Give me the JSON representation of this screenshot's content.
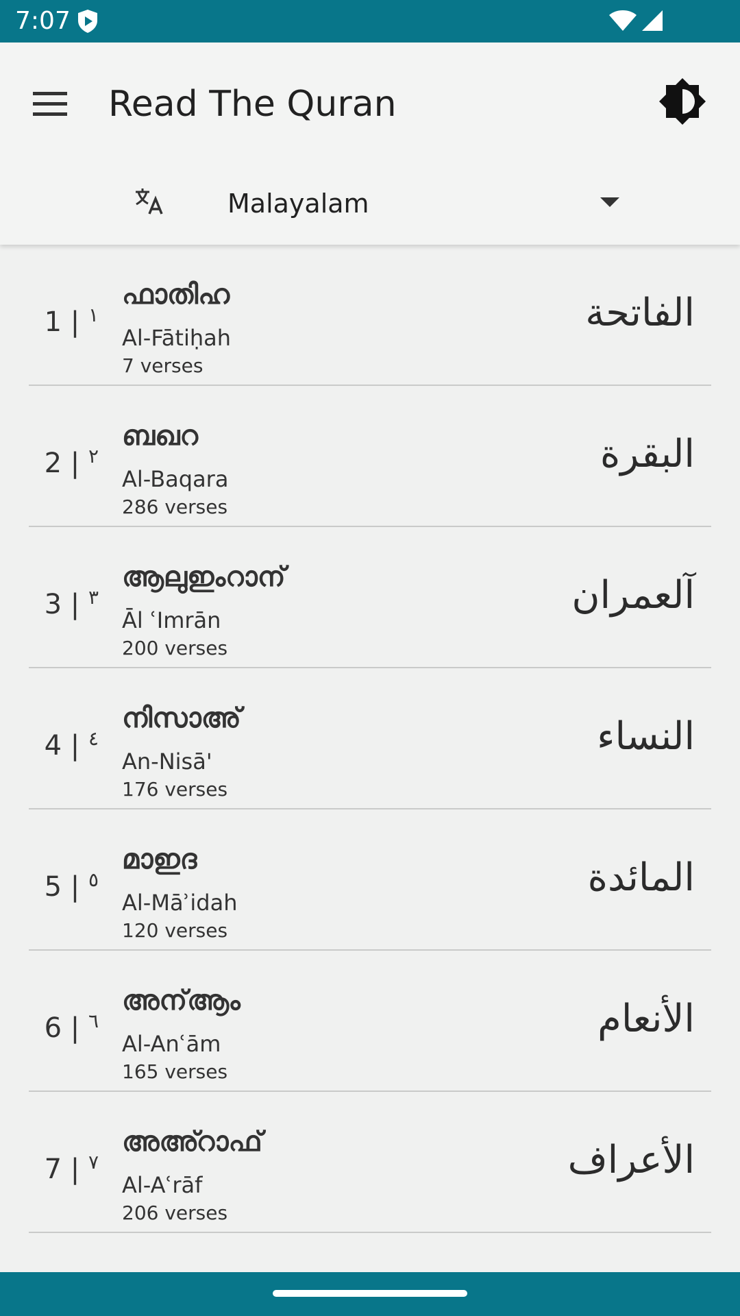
{
  "status_bar": {
    "time": "7:07",
    "icons": [
      "shield-icon",
      "wifi-icon",
      "signal-icon"
    ],
    "color": "#08768a"
  },
  "app_bar": {
    "menu_icon": "menu-icon",
    "title": "Read The Quran",
    "theme_icon": "brightness-icon"
  },
  "language": {
    "icon": "translate-icon",
    "selected": "Malayalam"
  },
  "surahs": [
    {
      "num": "1",
      "num_ar": "١",
      "local": "ഫാതിഹ",
      "translit": "Al-Fātiḥah",
      "verses": "7 verses",
      "arabic": "الفاتحة"
    },
    {
      "num": "2",
      "num_ar": "٢",
      "local": "ബഖറ",
      "translit": "Al-Baqara",
      "verses": "286 verses",
      "arabic": "البقرة"
    },
    {
      "num": "3",
      "num_ar": "٣",
      "local": "ആലുഇംറാന്",
      "translit": "Āl ʿImrān",
      "verses": "200 verses",
      "arabic": "آلعمران"
    },
    {
      "num": "4",
      "num_ar": "٤",
      "local": "നിസാഅ്",
      "translit": "An-Nisā'",
      "verses": "176 verses",
      "arabic": "النساء"
    },
    {
      "num": "5",
      "num_ar": "٥",
      "local": "മാഇദ",
      "translit": "Al-Māʾidah",
      "verses": "120 verses",
      "arabic": "المائدة"
    },
    {
      "num": "6",
      "num_ar": "٦",
      "local": "അന്ആം",
      "translit": "Al-Anʿām",
      "verses": "165 verses",
      "arabic": "الأنعام"
    },
    {
      "num": "7",
      "num_ar": "٧",
      "local": "അഅ്റാഫ്",
      "translit": "Al-Aʿrāf",
      "verses": "206 verses",
      "arabic": "الأعراف"
    }
  ],
  "nav_bar": {
    "color": "#08768a"
  }
}
